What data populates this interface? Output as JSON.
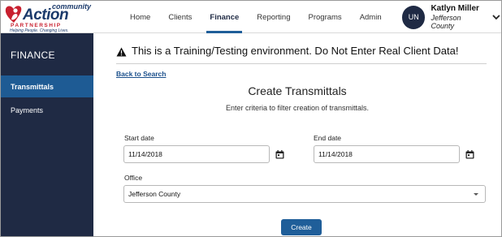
{
  "logo": {
    "line1": "community",
    "line2": "Action",
    "line3": "PARTNERSHIP",
    "tagline": "Helping People. Changing Lives."
  },
  "nav": {
    "items": [
      {
        "label": "Home",
        "active": false
      },
      {
        "label": "Clients",
        "active": false
      },
      {
        "label": "Finance",
        "active": true
      },
      {
        "label": "Reporting",
        "active": false
      },
      {
        "label": "Programs",
        "active": false
      },
      {
        "label": "Admin",
        "active": false
      }
    ]
  },
  "user": {
    "initials": "UN",
    "name": "Katlyn Miller",
    "county": "Jefferson County"
  },
  "sidebar": {
    "title": "FINANCE",
    "items": [
      {
        "label": "Transmittals",
        "active": true
      },
      {
        "label": "Payments",
        "active": false
      }
    ]
  },
  "main": {
    "warning": "This is a Training/Testing environment. Do Not Enter Real Client Data!",
    "back_link": "Back to Search",
    "title": "Create Transmittals",
    "subtitle": "Enter criteria to filter creation of transmittals.",
    "start_date_label": "Start date",
    "start_date_value": "11/14/2018",
    "end_date_label": "End date",
    "end_date_value": "11/14/2018",
    "office_label": "Office",
    "office_value": "Jefferson County",
    "create_label": "Create"
  },
  "colors": {
    "navy": "#1f2a44",
    "accent_blue": "#1f5e99",
    "logo_red": "#c8202f"
  }
}
